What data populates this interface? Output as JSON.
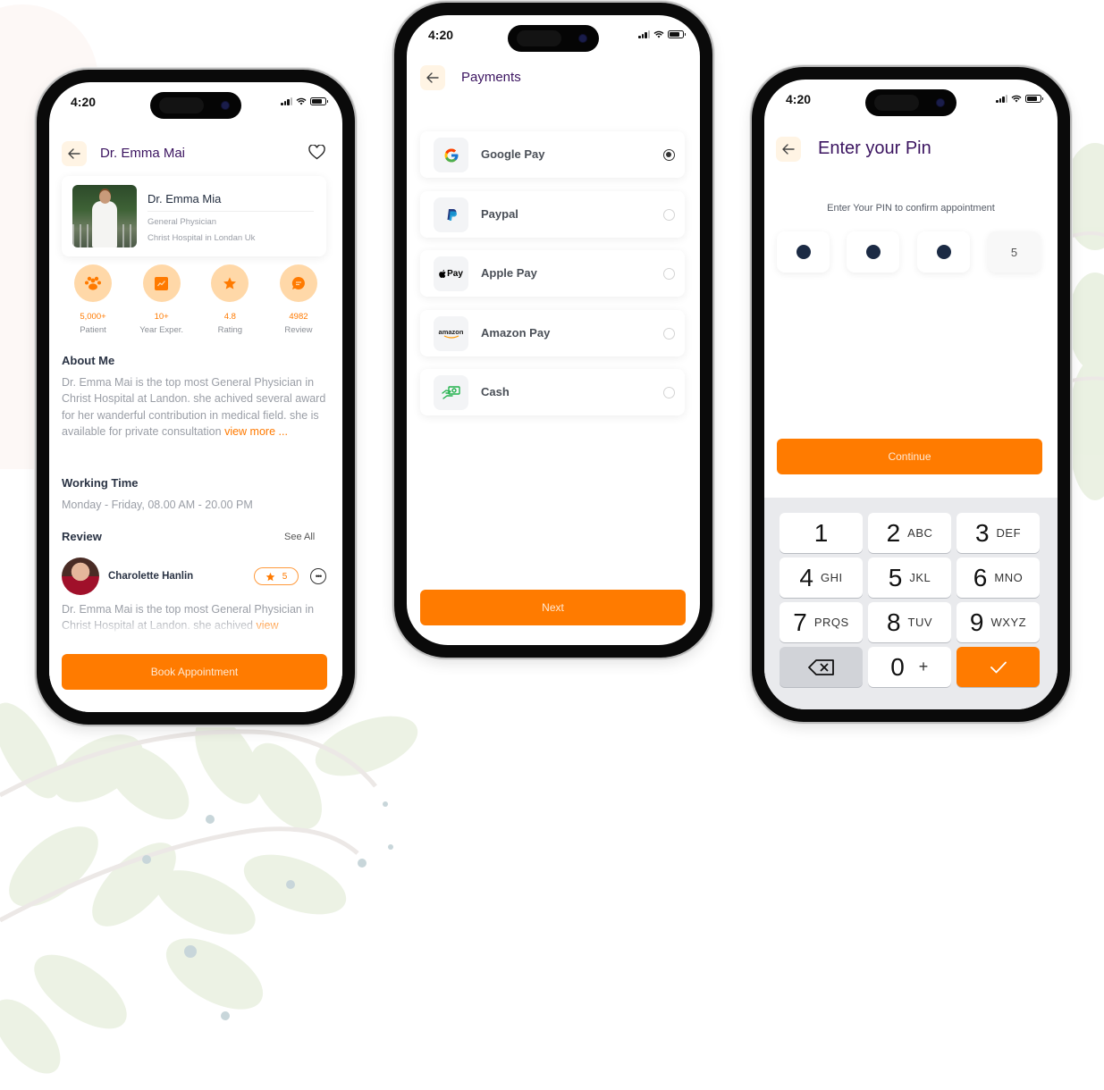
{
  "colors": {
    "accent": "#ff7b00",
    "title_purple": "#3b1460",
    "stat_circle": "#ffd8a8",
    "pin_dot": "#1b2a44",
    "keypad_bg": "#e9eaed"
  },
  "status_bar": {
    "time": "4:20"
  },
  "doctor_screen": {
    "header": {
      "back_icon": "arrow-left-icon",
      "title": "Dr. Emma Mai",
      "favorite_icon": "heart-icon"
    },
    "card": {
      "name": "Dr. Emma Mia",
      "specialty": "General Physician",
      "hospital": "Christ Hospital in Londan Uk"
    },
    "stats": [
      {
        "icon": "patients-icon",
        "value": "5,000+",
        "label": "Patient"
      },
      {
        "icon": "chart-icon",
        "value": "10+",
        "label": "Year Exper."
      },
      {
        "icon": "star-icon",
        "value": "4.8",
        "label": "Rating"
      },
      {
        "icon": "chat-icon",
        "value": "4982",
        "label": "Review"
      }
    ],
    "about": {
      "title": "About Me",
      "text": "Dr. Emma Mai is the top most General Physician in Christ Hospital at Landon. she achived several award for her wanderful contribution in medical field. she is available for private consultation ",
      "link": "view more ..."
    },
    "working_time": {
      "title": "Working Time",
      "text": "Monday - Friday, 08.00 AM - 20.00 PM"
    },
    "review": {
      "title": "Review",
      "see_all": "See All",
      "reviewer": "Charolette Hanlin",
      "rating": "5",
      "text": "Dr. Emma Mai is the top most General Physician in Christ Hospital at Landon. she achived ",
      "link": "view"
    },
    "cta": "Book Appointment"
  },
  "payments_screen": {
    "header": {
      "title": "Payments"
    },
    "methods": [
      {
        "icon": "google-icon",
        "label": "Google Pay",
        "selected": true
      },
      {
        "icon": "paypal-icon",
        "label": "Paypal",
        "selected": false
      },
      {
        "icon": "apple-pay-icon",
        "label": "Apple Pay",
        "selected": false
      },
      {
        "icon": "amazon-icon",
        "label": "Amazon Pay",
        "selected": false
      },
      {
        "icon": "cash-icon",
        "label": "Cash",
        "selected": false
      }
    ],
    "apple_pay_text": "Pay",
    "amazon_text": "amazon",
    "cta": "Next"
  },
  "pin_screen": {
    "header": {
      "title": "Enter your Pin"
    },
    "subtitle": "Enter Your PIN to confirm appointment",
    "pin_filled": 3,
    "pin_last_digit": "5",
    "cta": "Continue",
    "keypad": [
      {
        "num": "1",
        "letters": ""
      },
      {
        "num": "2",
        "letters": "ABC"
      },
      {
        "num": "3",
        "letters": "DEF"
      },
      {
        "num": "4",
        "letters": "GHI"
      },
      {
        "num": "5",
        "letters": "JKL"
      },
      {
        "num": "6",
        "letters": "MNO"
      },
      {
        "num": "7",
        "letters": "PRQS"
      },
      {
        "num": "8",
        "letters": "TUV"
      },
      {
        "num": "9",
        "letters": "WXYZ"
      },
      {
        "num": "0",
        "letters": "+"
      }
    ],
    "backspace_icon": "backspace-icon",
    "confirm_icon": "check-icon"
  }
}
